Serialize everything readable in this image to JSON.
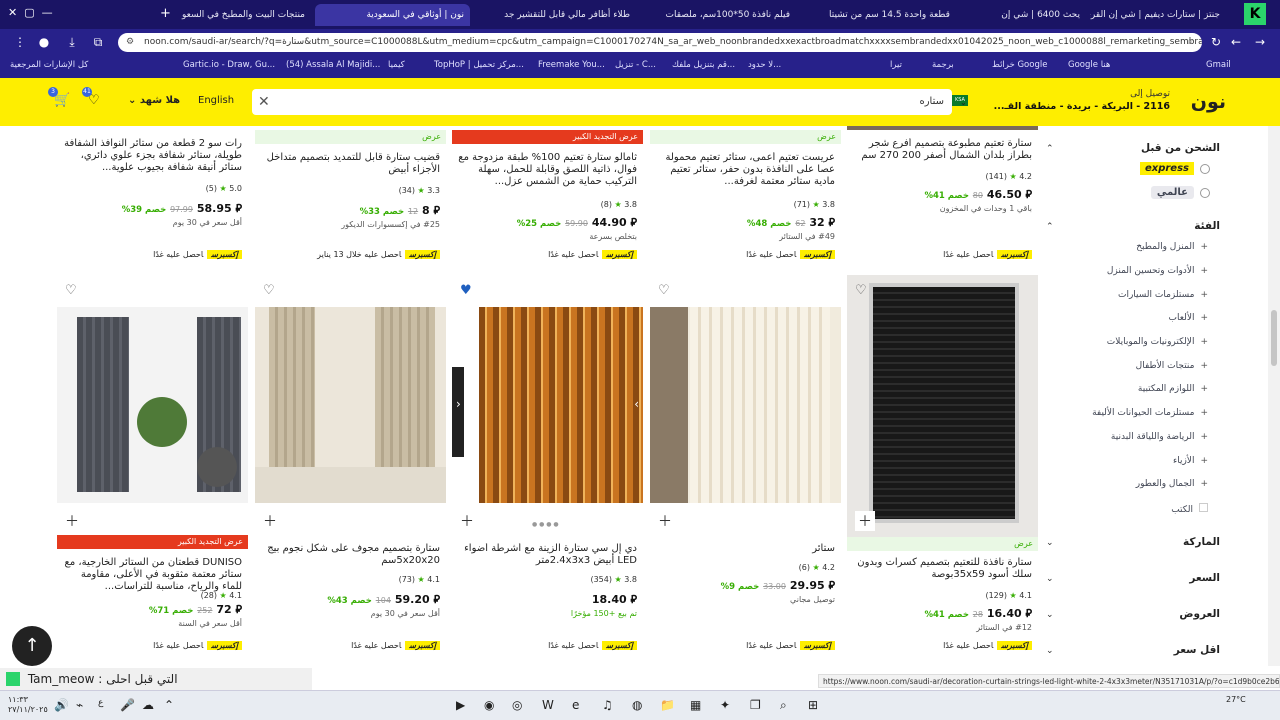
{
  "browser": {
    "tabs": [
      {
        "label": "جنتز | ستارات ديفيم | شي إن القرى",
        "active": false
      },
      {
        "label": "يحث 6400 | شي إن",
        "active": false
      },
      {
        "label": "قطعة واحدة 14.5 سم من تشيتا",
        "active": false
      },
      {
        "label": "فيلم نافذة 50*100سم، ملصقات",
        "active": false
      },
      {
        "label": "طلاء أظافر مالي قابل للتقشير جد",
        "active": false
      },
      {
        "label": "نون | أوثاقي في السعودية",
        "active": true
      },
      {
        "label": "منتجات البيت والمطبخ في السعو",
        "active": false
      }
    ],
    "url": "noon.com/saudi-ar/search/?q=ستارة&utm_source=C1000088L&utm_medium=cpc&utm_campaign=C1000170274N_sa_ar_web_noonbrandedxxexactbroadmatchxxxxsembrandedxx01042025_noon_web_c1000088l_remarketing_sembranded_&gclid=C...",
    "bookmarks": [
      "كل الإشارات المرجعية",
      "Gartic.io - Draw, Gu...",
      "(54) Assala Al Majidi...",
      "كيميا",
      "TopHoP | مركز تحميل...",
      "Freemake You...",
      "تنزيل - C...",
      "قم بتنزيل ملفك...",
      "لا حدود...",
      "تيرا",
      "برجمة",
      "خرائط Google",
      "Google هنا",
      "Gmail"
    ]
  },
  "header": {
    "logo": "نون",
    "deliver_to": "توصيل إلى",
    "location": "2116 - البريكة - بريدة - منطقة القـ...",
    "search_value": "ستاره",
    "lang": "English",
    "user": "هلا شهد",
    "wishlist_count": "41",
    "cart_count": "3"
  },
  "sidebar": {
    "shipping_title": "الشحن من قبل",
    "express": "express",
    "global": "عالمي",
    "category_title": "الفئة",
    "categories": [
      "المنزل والمطبخ",
      "الأدوات وتحسين المنزل",
      "مستلزمات السيارات",
      "الألعاب",
      "الإلكترونيات والموبايلات",
      "منتجات الأطفال",
      "اللوازم المكتبية",
      "مستلزمات الحيوانات الأليفة",
      "الرياضة واللياقة البدنية",
      "الأزياء",
      "الجمال والعطور",
      "الكتب"
    ],
    "brand_title": "الماركة",
    "price_title": "السعر",
    "offers_title": "العروض",
    "lowest_title": "اقل سعر"
  },
  "row1": [
    {
      "title": "ستارة تعتيم مطبوعة بتصميم أفرع شجر بطراز بلدان الشمال أصفر 200 270 سم",
      "rating": "4.2",
      "count": "(141)",
      "price": "46.50",
      "old": "80",
      "disc": "خصم 41%",
      "note": "باقي 1 وحدات في المخزون",
      "exp": "احصل عليه غدًا"
    },
    {
      "title": "عريست تعتيم أعمى، ستائر تعتيم محمولة عصا على النافذة بدون حفر، ستائر تعتيم مادية ستائر معتمة لغرفة...",
      "rating": "3.8",
      "count": "(71)",
      "price": "32",
      "old": "62",
      "disc": "خصم 48%",
      "note": "#49 في الستائر",
      "exp": "احصل عليه غدًا",
      "bar": "عرض"
    },
    {
      "title": "ثامالو ستارة تعتيم 100% طبقة مزدوجة مع فوال، ذاتية اللصق وقابلة للحمل، سهلة التركيب حماية من الشمس عزل...",
      "rating": "3.8",
      "count": "(8)",
      "price": "44.90",
      "old": "59.90",
      "disc": "خصم 25%",
      "note": "بتخلص بسرعة",
      "exp": "احصل عليه غدًا",
      "bar": "عرض التجديد الكبير"
    },
    {
      "title": "قضيب ستارة قابل للتمديد بتصميم متداخل الأجزاء أبيض",
      "rating": "3.3",
      "count": "(34)",
      "price": "8",
      "old": "12",
      "disc": "خصم 33%",
      "note": "#25 في إكسسوارات الديكور",
      "exp": "احصل عليه خلال 13 يناير",
      "bar": "عرض"
    },
    {
      "title": "رات سو 2 قطعة من ستائر النوافذ الشفافة طويلة، ستائر شفافة بجزء علوي دائري، ستائر أنيقة شفافة بجيوب علوية...",
      "rating": "5.0",
      "count": "(5)",
      "price": "58.95",
      "old": "97.99",
      "disc": "خصم 39%",
      "note": "أقل سعر في 30 يوم",
      "exp": "احصل عليه غدًا"
    }
  ],
  "row2": [
    {
      "title": "ستارة نافذة للتعتيم بتصميم كسرات وبدون سلك أسود 35x59بوصة",
      "rating": "4.1",
      "count": "(129)",
      "price": "16.40",
      "old": "28",
      "disc": "خصم 41%",
      "note": "#12 في الستائر",
      "exp": "احصل عليه غدًا",
      "bar": "عرض"
    },
    {
      "title": "ستائر",
      "rating": "4.2",
      "count": "(6)",
      "price": "29.95",
      "old": "33.00",
      "disc": "خصم 9%",
      "note": "توصيل مجاني",
      "exp": "احصل عليه غدًا"
    },
    {
      "title": "دي إل سي ستارة الزينة مع أشرطة أضواء LED أبيض 2.4x3x3متر",
      "rating": "3.8",
      "count": "(354)",
      "price": "18.40",
      "old": "",
      "disc": "",
      "note": "تم بيع +150 مؤخرًا",
      "exp": "احصل عليه غدًا"
    },
    {
      "title": "ستارة بتصميم مجوف على شكل نجوم بيج 5x20x20سم",
      "rating": "4.1",
      "count": "(73)",
      "price": "59.20",
      "old": "104",
      "disc": "خصم 43%",
      "note": "أقل سعر في 30 يوم",
      "exp": "احصل عليه غدًا"
    },
    {
      "title": "DUNISO قطعتان من الستائر الخارجية، مع ستائر معتمة مثقوبة في الأعلى، مقاومة للماء والرياح، مناسبة للتراسات...",
      "rating": "4.1",
      "count": "(28)",
      "price": "72",
      "old": "252",
      "disc": "خصم 71%",
      "note": "أقل سعر في السنة",
      "exp": "احصل عليه غدًا",
      "bar": "عرض التجديد الكبير"
    }
  ],
  "express_tag": "إكسبرس",
  "status_url": "https://www.noon.com/saudi-ar/decoration-curtain-strings-led-light-white-2-4x3x3meter/N35171031A/p/?o=c1d9b0ce2b6c6f8d",
  "toast": "Tam_meow : التي قبل احلى",
  "clock": {
    "time": "١١:٣٣",
    "date": "٢٧/١١/٢٠٢٥"
  },
  "weather": "27°C",
  "colors": {
    "noon_yellow": "#feee00",
    "promo_red": "#e53a1e",
    "offer_green": "#38ae04"
  }
}
